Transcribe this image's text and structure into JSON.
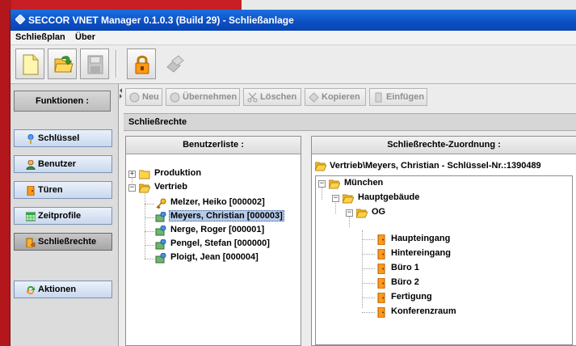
{
  "window": {
    "title": "SECCOR VNET Manager 0.1.0.3 (Build 29) - Schließanlage"
  },
  "menu": [
    {
      "label": "Schließplan"
    },
    {
      "label": "Über"
    }
  ],
  "sidebar": {
    "header": "Funktionen :",
    "items": [
      {
        "label": "Schlüssel",
        "icon": "key-icon"
      },
      {
        "label": "Benutzer",
        "icon": "user-icon"
      },
      {
        "label": "Türen",
        "icon": "door-icon"
      },
      {
        "label": "Zeitprofile",
        "icon": "calendar-icon"
      },
      {
        "label": "Schließrechte",
        "icon": "lock-rights-icon",
        "active": true
      }
    ],
    "actions_label": "Aktionen"
  },
  "actionbar": [
    {
      "label": "Neu"
    },
    {
      "label": "Übernehmen"
    },
    {
      "label": "Löschen"
    },
    {
      "label": "Kopieren"
    },
    {
      "label": "Einfügen"
    }
  ],
  "section_title": "Schließrechte",
  "user_list": {
    "title": "Benutzerliste :",
    "groups": [
      {
        "label": "Produktion",
        "expanded": false
      },
      {
        "label": "Vertrieb",
        "expanded": true
      }
    ],
    "users": [
      {
        "label": "Melzer, Heiko [000002]",
        "icon": "key-icon"
      },
      {
        "label": "Meyers, Christian [000003]",
        "icon": "user-key-icon",
        "selected": true
      },
      {
        "label": "Nerge, Roger [000001]",
        "icon": "user-key-icon"
      },
      {
        "label": "Pengel, Stefan [000000]",
        "icon": "user-key-icon"
      },
      {
        "label": "Ploigt, Jean [000004]",
        "icon": "user-key-icon"
      }
    ]
  },
  "assignment": {
    "title": "Schließrechte-Zuordnung :",
    "path": "Vertrieb\\Meyers, Christian - Schlüssel-Nr.:1390489",
    "tree": {
      "site": "München",
      "building": "Hauptgebäude",
      "floor": "OG",
      "doors": [
        "Haupteingang",
        "Hintereingang",
        "Büro 1",
        "Büro 2",
        "Fertigung",
        "Konferenzraum"
      ]
    }
  }
}
